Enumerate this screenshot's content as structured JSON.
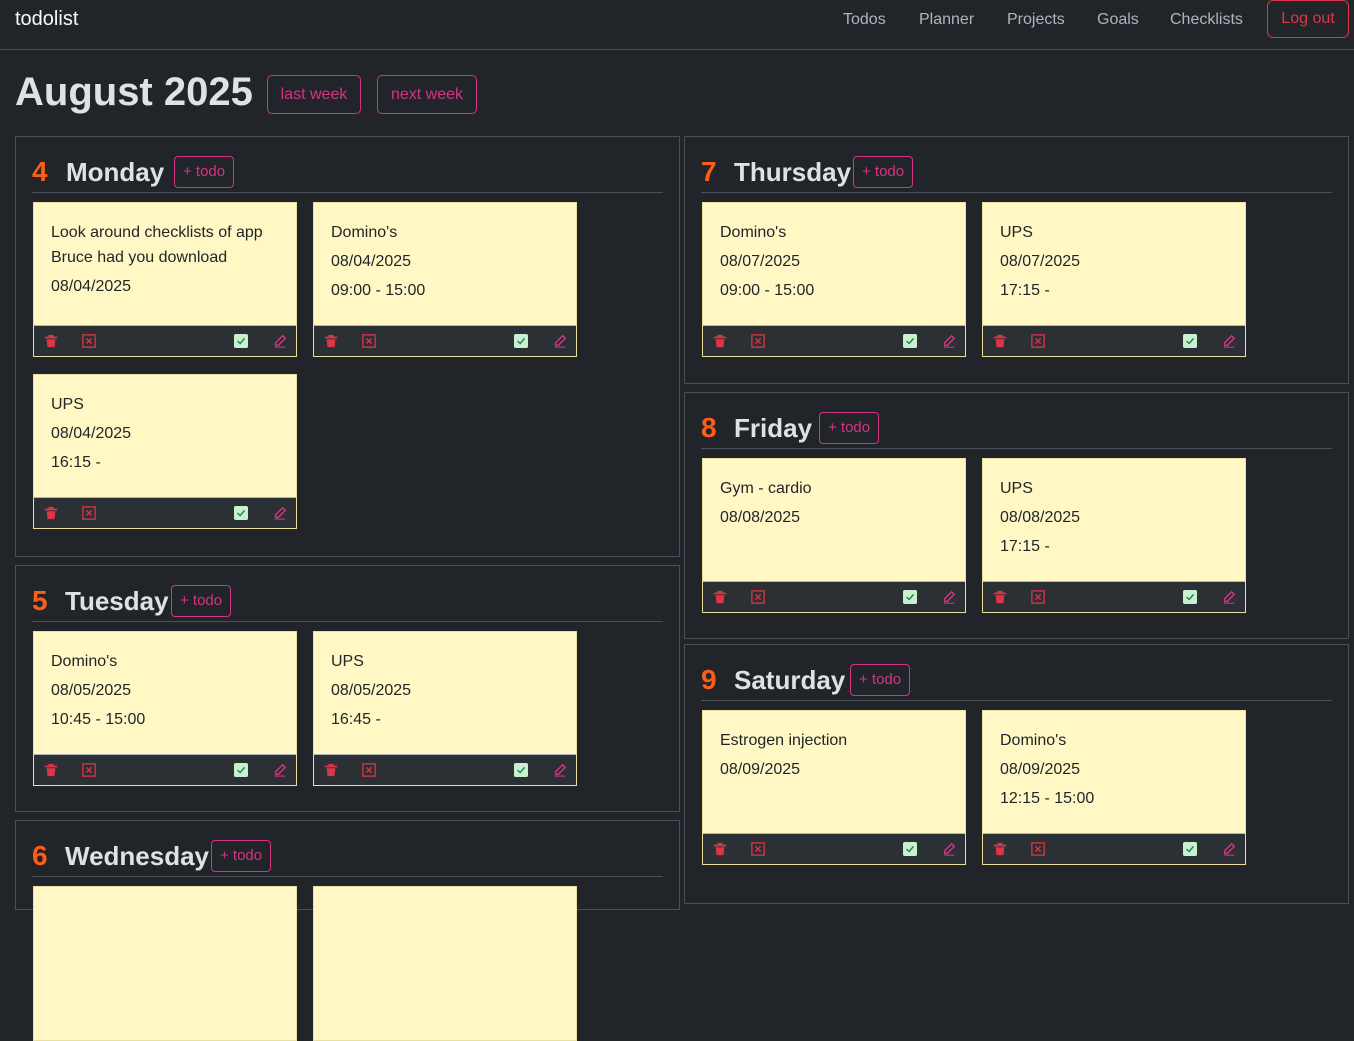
{
  "brand": "todolist",
  "nav": [
    "Todos",
    "Planner",
    "Projects",
    "Goals",
    "Checklists"
  ],
  "logout": "Log out",
  "month": "August 2025",
  "buttons": {
    "last": "last week",
    "next": "next week",
    "add": "+ todo"
  },
  "days": [
    {
      "num": "4",
      "name": "Monday",
      "todos": [
        {
          "title": "Look around checklists of app Bruce had you download",
          "date": "08/04/2025",
          "time": ""
        },
        {
          "title": "Domino's",
          "date": "08/04/2025",
          "time": "09:00 - 15:00"
        },
        {
          "title": "UPS",
          "date": "08/04/2025",
          "time": "16:15 -"
        }
      ]
    },
    {
      "num": "5",
      "name": "Tuesday",
      "todos": [
        {
          "title": "Domino's",
          "date": "08/05/2025",
          "time": "10:45 - 15:00"
        },
        {
          "title": "UPS",
          "date": "08/05/2025",
          "time": "16:45 -"
        }
      ]
    },
    {
      "num": "6",
      "name": "Wednesday",
      "todos": []
    },
    {
      "num": "7",
      "name": "Thursday",
      "todos": [
        {
          "title": "Domino's",
          "date": "08/07/2025",
          "time": "09:00 - 15:00"
        },
        {
          "title": "UPS",
          "date": "08/07/2025",
          "time": "17:15 -"
        }
      ]
    },
    {
      "num": "8",
      "name": "Friday",
      "todos": [
        {
          "title": "Gym - cardio",
          "date": "08/08/2025",
          "time": ""
        },
        {
          "title": "UPS",
          "date": "08/08/2025",
          "time": "17:15 -"
        }
      ]
    },
    {
      "num": "9",
      "name": "Saturday",
      "todos": [
        {
          "title": "Estrogen injection",
          "date": "08/09/2025",
          "time": ""
        },
        {
          "title": "Domino's",
          "date": "08/09/2025",
          "time": "12:15 - 15:00"
        }
      ]
    }
  ],
  "icons": {
    "delete": "trash-icon",
    "dismiss": "x-square-icon",
    "complete": "check-square-icon",
    "edit": "pencil-icon"
  },
  "colors": {
    "accent": "#d63384",
    "day_number": "#fd5d14",
    "card": "#fff8c5",
    "danger": "#dc3545",
    "check": "#c8f0cf"
  }
}
